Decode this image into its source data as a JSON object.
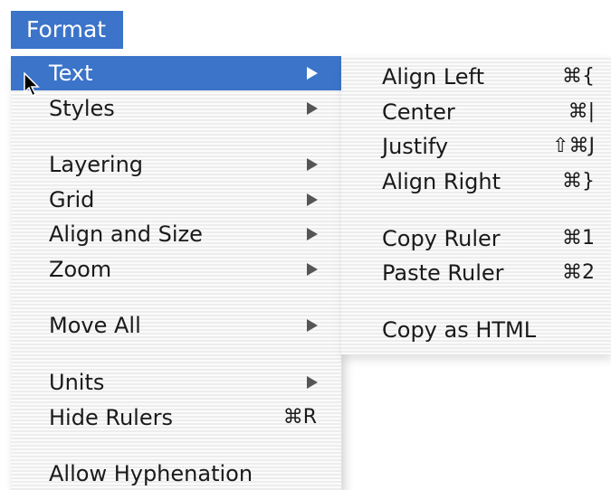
{
  "menubar": {
    "title": "Format"
  },
  "format_menu": {
    "items": [
      {
        "label": "Text",
        "submenu": true,
        "selected": true
      },
      {
        "label": "Styles",
        "submenu": true
      },
      {
        "label": "Layering",
        "submenu": true
      },
      {
        "label": "Grid",
        "submenu": true
      },
      {
        "label": "Align and Size",
        "submenu": true
      },
      {
        "label": "Zoom",
        "submenu": true
      },
      {
        "label": "Move All",
        "submenu": true
      },
      {
        "label": "Units",
        "submenu": true
      },
      {
        "label": "Hide Rulers",
        "shortcut": "⌘R"
      },
      {
        "label": "Allow Hyphenation"
      }
    ]
  },
  "text_submenu": {
    "items": [
      {
        "label": "Align Left",
        "shortcut": "⌘{"
      },
      {
        "label": "Center",
        "shortcut": "⌘|"
      },
      {
        "label": "Justify",
        "shortcut": "⇧⌘J"
      },
      {
        "label": "Align Right",
        "shortcut": "⌘}"
      },
      {
        "label": "Copy Ruler",
        "shortcut": "⌘1"
      },
      {
        "label": "Paste Ruler",
        "shortcut": "⌘2"
      },
      {
        "label": "Copy as HTML"
      }
    ]
  },
  "colors": {
    "selection": "#3b74c9",
    "menu_background": "#fafafa",
    "menu_text": "#1a1a1a"
  },
  "icons": {
    "cursor": "arrow-cursor-icon",
    "submenu_indicator": "triangle-right-icon"
  }
}
